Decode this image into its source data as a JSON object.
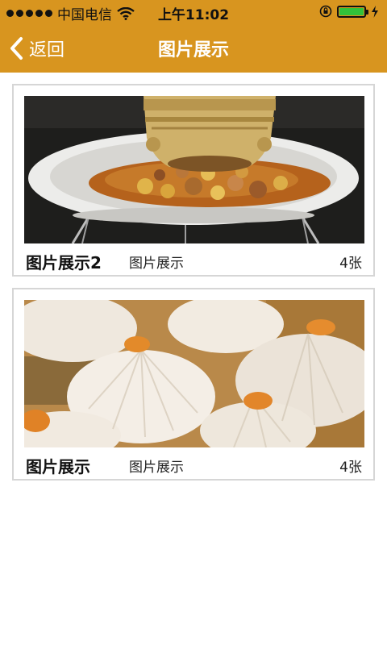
{
  "status_bar": {
    "carrier": "中国电信",
    "time": "上午11:02",
    "icons": [
      "signal-dots-icon",
      "wifi-icon",
      "rotation-lock-icon",
      "battery-icon",
      "charging-icon"
    ]
  },
  "nav": {
    "back_label": "返回",
    "title": "图片展示",
    "colors": {
      "bar": "#d8951f",
      "text": "#ffffff"
    }
  },
  "cards": [
    {
      "title": "图片展示2",
      "subtitle": "图片展示",
      "count": "4张",
      "image": "food-dish-photo"
    },
    {
      "title": "图片展示",
      "subtitle": "图片展示",
      "count": "4张",
      "image": "soup-dumplings-photo"
    }
  ]
}
